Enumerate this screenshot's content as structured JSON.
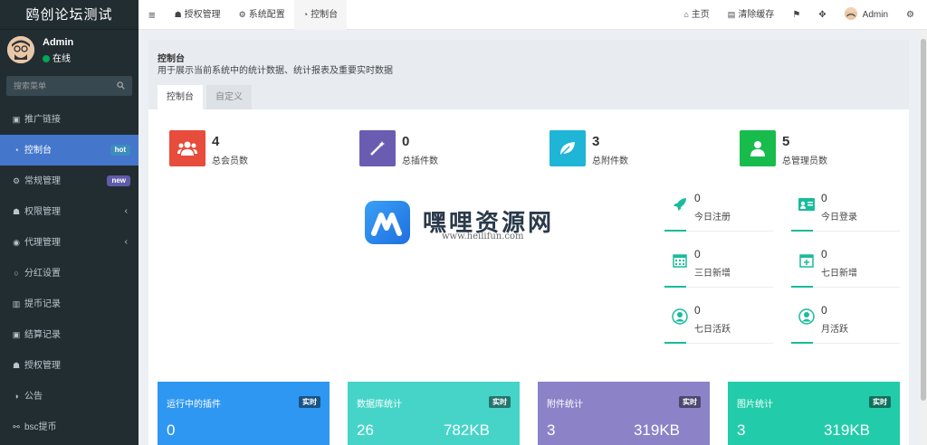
{
  "app": {
    "title": "鸥创论坛测试"
  },
  "user": {
    "name": "Admin",
    "status": "在线"
  },
  "search": {
    "placeholder": "搜索菜单"
  },
  "sidebar": {
    "items": [
      {
        "label": "推广链接",
        "icon": "link-icon"
      },
      {
        "label": "控制台",
        "icon": "dashboard-icon",
        "badge": "hot"
      },
      {
        "label": "常规管理",
        "icon": "cogs-icon",
        "badge": "new"
      },
      {
        "label": "权限管理",
        "icon": "group-icon"
      },
      {
        "label": "代理管理",
        "icon": "user-circle-icon"
      },
      {
        "label": "分红设置",
        "icon": "circle-icon"
      },
      {
        "label": "提币记录",
        "icon": "bank-icon"
      },
      {
        "label": "结算记录",
        "icon": "ticket-icon"
      },
      {
        "label": "授权管理",
        "icon": "group-icon"
      },
      {
        "label": "公告",
        "icon": "adjust-icon"
      },
      {
        "label": "bsc提币",
        "icon": "bicycle-icon"
      }
    ]
  },
  "topnav": {
    "tabs": [
      {
        "label": "授权管理"
      },
      {
        "label": "系统配置"
      },
      {
        "label": "控制台"
      }
    ],
    "home": "主页",
    "clear_cache": "清除缓存",
    "admin": "Admin"
  },
  "panel": {
    "title": "控制台",
    "subtitle": "用于展示当前系统中的统计数据、统计报表及重要实时数据",
    "tabs": [
      "控制台",
      "自定义"
    ]
  },
  "stats": [
    {
      "value": "4",
      "label": "总会员数",
      "color": "#e74c3c"
    },
    {
      "value": "0",
      "label": "总插件数",
      "color": "#6a5cb0"
    },
    {
      "value": "3",
      "label": "总附件数",
      "color": "#1fb5d6"
    },
    {
      "value": "5",
      "label": "总管理员数",
      "color": "#18bc4c"
    }
  ],
  "minis": [
    {
      "value": "0",
      "label": "今日注册"
    },
    {
      "value": "0",
      "label": "今日登录"
    },
    {
      "value": "0",
      "label": "三日新增"
    },
    {
      "value": "0",
      "label": "七日新增"
    },
    {
      "value": "0",
      "label": "七日活跃"
    },
    {
      "value": "0",
      "label": "月活跃"
    }
  ],
  "cards": [
    {
      "title": "运行中的插件",
      "tag": "实时",
      "v1": "0",
      "v2": "",
      "color": "#2e97f1"
    },
    {
      "title": "数据库统计",
      "tag": "实时",
      "v1": "26",
      "v2": "782KB",
      "color": "#46d4c8"
    },
    {
      "title": "附件统计",
      "tag": "实时",
      "v1": "3",
      "v2": "319KB",
      "color": "#8c82c8"
    },
    {
      "title": "图片统计",
      "tag": "实时",
      "v1": "3",
      "v2": "319KB",
      "color": "#22ccaa"
    }
  ],
  "watermark": {
    "title": "嘿哩资源网",
    "url": "www.heilifun.com"
  },
  "colors": {
    "accent": "#18bc9c",
    "sidebar": "#222d32",
    "active": "#4477cc"
  }
}
